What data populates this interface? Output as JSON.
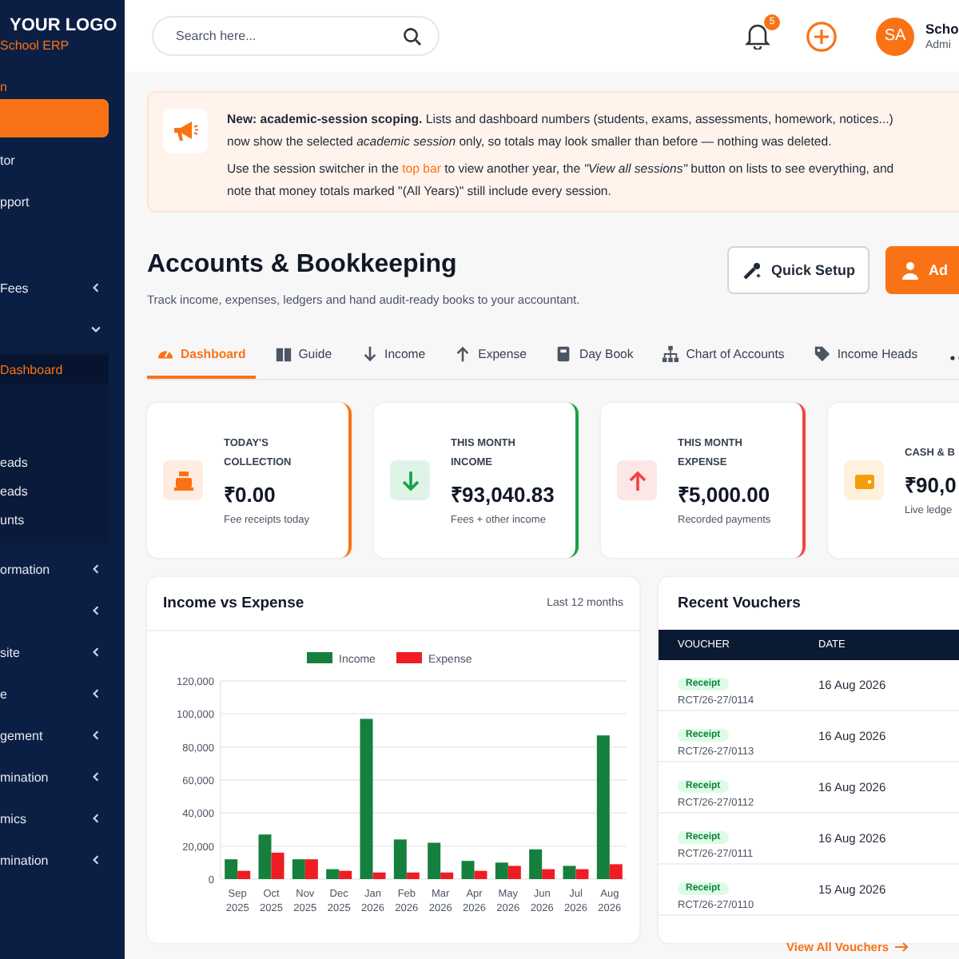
{
  "sidebar": {
    "logo": "YOUR LOGO",
    "subtitle": "School ERP",
    "section": "n",
    "items": [
      {
        "selected": true
      },
      {
        "label": "tor",
        "selected": false
      },
      {
        "label": "pport",
        "selected": false
      },
      {
        "label": "Fees",
        "selected": false,
        "expanded": false
      },
      {
        "selected": false,
        "expanded": true,
        "children": [
          {
            "label": "Dashboard",
            "selected": true
          },
          {
            "label": "eads",
            "selected": false
          },
          {
            "label": "eads",
            "selected": false
          },
          {
            "label": "unts",
            "selected": false
          }
        ]
      },
      {
        "label": "ormation",
        "selected": false,
        "expanded": false
      },
      {
        "selected": false,
        "expanded": false
      },
      {
        "label": "site",
        "selected": false,
        "expanded": false
      },
      {
        "label": "e",
        "selected": false,
        "expanded": false
      },
      {
        "label": "gement",
        "selected": false,
        "expanded": false
      },
      {
        "label": "mination",
        "selected": false,
        "expanded": false
      },
      {
        "label": "mics",
        "selected": false,
        "expanded": false
      },
      {
        "label": "mination",
        "selected": false,
        "expanded": false
      }
    ]
  },
  "topbar": {
    "search": {
      "placeholder": "Search here..."
    },
    "notifications": "5",
    "avatar": "SA",
    "user_name": "Scho",
    "user_role": "Admi"
  },
  "banner": {
    "note_1": "**New: academic-session scoping.** Lists and dashboard numbers (students, exams, assessments, homework, notices...) now show the selected *academic session* only, so totals may look smaller than before — nothing was deleted.",
    "note_2": {
      "before": "Use the session switcher in the ",
      "link": "top bar",
      "after": " to view another year, the *\"View all sessions\"* button on lists to see everything, and note that money totals marked \"(All Years)\" still include every session."
    }
  },
  "page": {
    "title": "Accounts & Bookkeeping",
    "subtitle": "Track income, expenses, ledgers and hand audit-ready books to your accountant.",
    "buttons": [
      {
        "label": "Quick Setup",
        "kind": "outline"
      },
      {
        "label": "Ad",
        "kind": "primary"
      }
    ]
  },
  "tabs": [
    {
      "label": "Dashboard",
      "selected": true
    },
    {
      "label": "Guide",
      "selected": false
    },
    {
      "label": "Income",
      "selected": false
    },
    {
      "label": "Expense",
      "selected": false
    },
    {
      "label": "Day Book",
      "selected": false
    },
    {
      "label": "Chart of Accounts",
      "selected": false
    },
    {
      "label": "Income Heads",
      "selected": false
    }
  ],
  "stats": [
    {
      "label": "TODAY'S COLLECTION",
      "value": "₹0.00",
      "note": "Fee receipts today",
      "color": "#f97316"
    },
    {
      "label": "THIS MONTH INCOME",
      "value": "₹93,040.83",
      "note": "Fees + other income",
      "color": "#16a34a"
    },
    {
      "label": "THIS MONTH EXPENSE",
      "value": "₹5,000.00",
      "note": "Recorded payments",
      "color": "#ef4444"
    },
    {
      "label": "CASH & B",
      "value": "₹90,0",
      "note": "Live ledge",
      "color": "#f59e0b"
    }
  ],
  "chart": {
    "title": "Income vs Expense",
    "period": "Last 12 months",
    "chart_data": {
      "type": "bar",
      "categories": [
        "Sep 2025",
        "Oct 2025",
        "Nov 2025",
        "Dec 2025",
        "Jan 2026",
        "Feb 2026",
        "Mar 2026",
        "Apr 2026",
        "May 2026",
        "Jun 2026",
        "Jul 2026",
        "Aug 2026"
      ],
      "series": [
        {
          "name": "Income",
          "color": "#15803d",
          "values": [
            12000,
            27000,
            12000,
            6000,
            97000,
            24000,
            22000,
            11000,
            10000,
            18000,
            8000,
            87000
          ]
        },
        {
          "name": "Expense",
          "color": "#ef1c24",
          "values": [
            5000,
            16000,
            12000,
            5000,
            4000,
            4000,
            4000,
            5000,
            8000,
            6000,
            6000,
            9000
          ]
        }
      ],
      "ylim": [
        0,
        120000
      ],
      "grid": true,
      "legend": true,
      "yticks": [
        {
          "value": 0,
          "label": "0"
        },
        {
          "value": 20000,
          "label": "20,000"
        },
        {
          "value": 40000,
          "label": "40,000"
        },
        {
          "value": 60000,
          "label": "60,000"
        },
        {
          "value": 80000,
          "label": "80,000"
        },
        {
          "value": 100000,
          "label": "100,000"
        },
        {
          "value": 120000,
          "label": "120,000"
        }
      ]
    }
  },
  "vouchers": {
    "title": "Recent Vouchers",
    "columns": [
      "VOUCHER",
      "DATE"
    ],
    "rows": [
      {
        "tag": "Receipt",
        "number": "RCT/26-27/0114",
        "date": "16 Aug 2026"
      },
      {
        "tag": "Receipt",
        "number": "RCT/26-27/0113",
        "date": "16 Aug 2026"
      },
      {
        "tag": "Receipt",
        "number": "RCT/26-27/0112",
        "date": "16 Aug 2026"
      },
      {
        "tag": "Receipt",
        "number": "RCT/26-27/0111",
        "date": "16 Aug 2026"
      },
      {
        "tag": "Receipt",
        "number": "RCT/26-27/0110",
        "date": "15 Aug 2026"
      }
    ],
    "footer_link": "View All Vouchers"
  }
}
